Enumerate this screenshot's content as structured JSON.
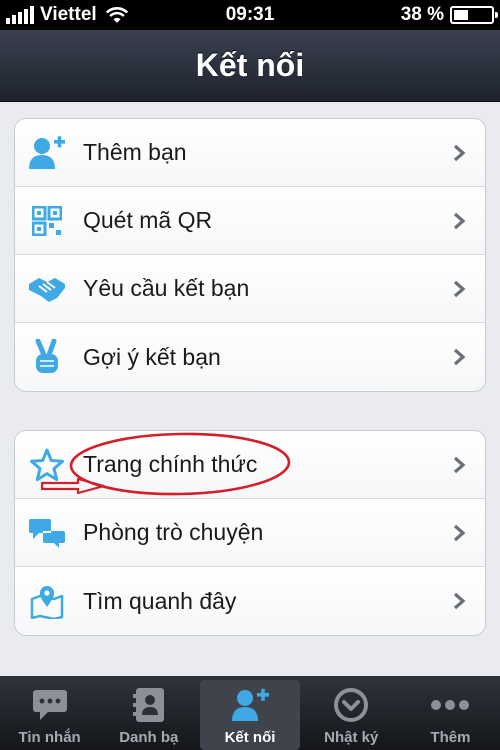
{
  "status_bar": {
    "carrier": "Viettel",
    "time": "09:31",
    "battery_percent": "38 %",
    "battery_level": 0.38
  },
  "header": {
    "title": "Kết nối"
  },
  "groups": [
    {
      "items": [
        {
          "label": "Thêm bạn",
          "icon": "add-friend-icon"
        },
        {
          "label": "Quét mã QR",
          "icon": "qr-code-icon"
        },
        {
          "label": "Yêu cầu kết bạn",
          "icon": "handshake-icon"
        },
        {
          "label": "Gợi ý kết bạn",
          "icon": "victory-hand-icon"
        }
      ]
    },
    {
      "items": [
        {
          "label": "Trang chính thức",
          "icon": "star-icon"
        },
        {
          "label": "Phòng trò chuyện",
          "icon": "chat-rooms-icon"
        },
        {
          "label": "Tìm quanh đây",
          "icon": "map-pin-icon"
        }
      ]
    }
  ],
  "tabbar": {
    "tabs": [
      {
        "label": "Tin nhắn",
        "icon": "message-icon",
        "active": false
      },
      {
        "label": "Danh bạ",
        "icon": "contacts-icon",
        "active": false
      },
      {
        "label": "Kết nối",
        "icon": "connect-icon",
        "active": true
      },
      {
        "label": "Nhật ký",
        "icon": "diary-icon",
        "active": false
      },
      {
        "label": "Thêm",
        "icon": "more-icon",
        "active": false
      }
    ]
  },
  "colors": {
    "accent_blue": "#3fa9e6",
    "annotation_red": "#d21f2a",
    "header_dark": "#1d222c"
  }
}
